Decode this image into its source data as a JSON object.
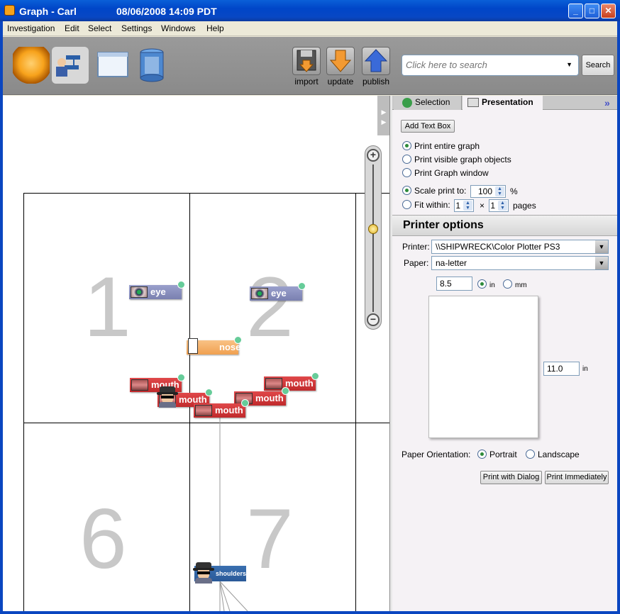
{
  "window": {
    "title": "Graph - Carl",
    "datetime": "08/06/2008 14:09 PDT"
  },
  "menu": [
    "Investigation",
    "Edit",
    "Select",
    "Settings",
    "Windows",
    "Help"
  ],
  "toolbar": {
    "import_label": "import",
    "update_label": "update",
    "publish_label": "publish",
    "search_placeholder": "Click here to search",
    "search_button": "Search"
  },
  "canvas": {
    "page_numbers": [
      "1",
      "2",
      "6",
      "7"
    ],
    "nodes": {
      "eye_left": "eye",
      "eye_right": "eye",
      "nose": "nose",
      "mouth_1": "mouth",
      "mouth_2": "mouth",
      "mouth_3": "mouth",
      "mouth_4": "mouth",
      "mouth_5": "mouth",
      "shoulders": "shoulders"
    }
  },
  "panel": {
    "tab_selection": "Selection",
    "tab_presentation": "Presentation",
    "add_text_box": "Add Text Box",
    "print_entire": "Print entire graph",
    "print_visible": "Print visible graph objects",
    "print_window": "Print Graph window",
    "scale_label": "Scale print to:",
    "scale_value": "100",
    "scale_unit": "%",
    "fit_label": "Fit within:",
    "fit_x": "1",
    "fit_times": "×",
    "fit_y": "1",
    "fit_unit": "pages",
    "printer_header": "Printer options",
    "printer_label": "Printer:",
    "printer_value": "\\\\SHIPWRECK\\Color Plotter PS3",
    "paper_label": "Paper:",
    "paper_value": "na-letter",
    "width_value": "8.5",
    "unit_in": "in",
    "unit_mm": "mm",
    "height_value": "11.0",
    "height_unit": "in",
    "orientation_label": "Paper Orientation:",
    "portrait": "Portrait",
    "landscape": "Landscape",
    "print_dialog": "Print with Dialog",
    "print_immediately": "Print Immediately"
  }
}
